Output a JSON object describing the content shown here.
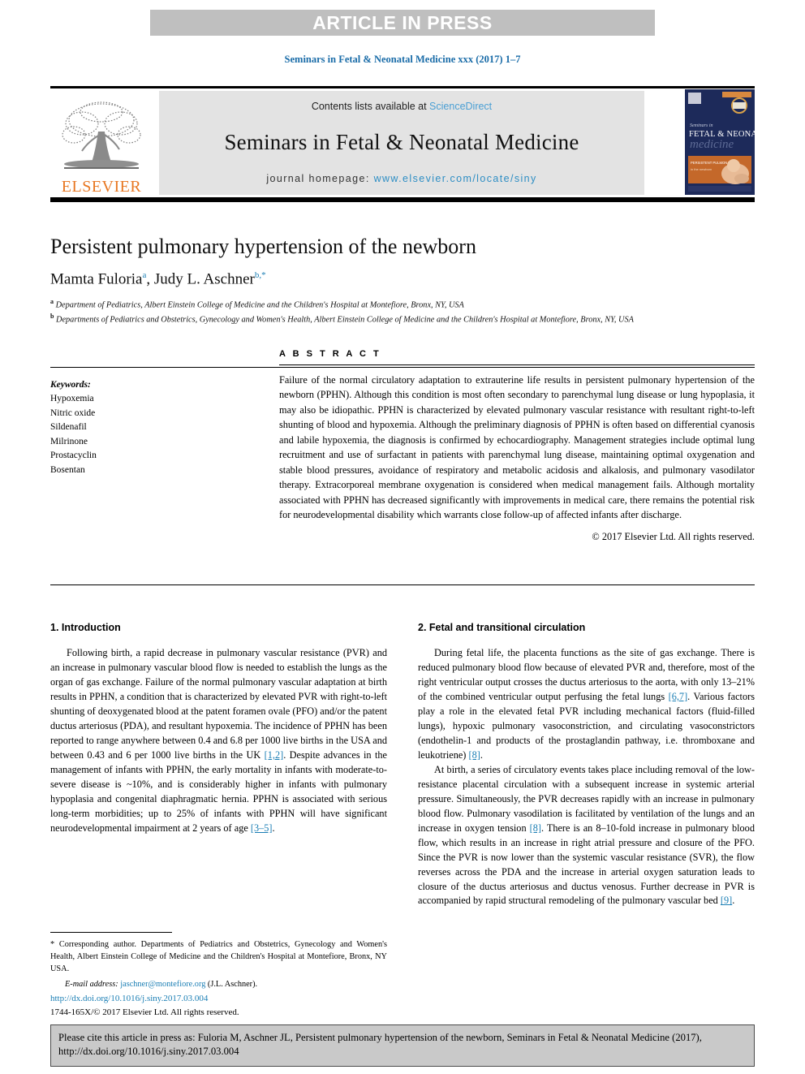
{
  "banner": {
    "text": "ARTICLE IN PRESS"
  },
  "running_citation": "Seminars in Fetal & Neonatal Medicine xxx (2017) 1–7",
  "masthead": {
    "publisher": "ELSEVIER",
    "contents_prefix": "Contents lists available at ",
    "contents_link": "ScienceDirect",
    "journal_name": "Seminars in Fetal & Neonatal Medicine",
    "homepage_prefix": "journal homepage: ",
    "homepage_link": "www.elsevier.com/locate/siny",
    "cover": {
      "line1": "Seminars in",
      "line2": "FETAL & NEONATAL",
      "line3": "medicine",
      "band_text": "PERSISTENT PULMONARY",
      "band_sub": "in the newborn"
    }
  },
  "article": {
    "title": "Persistent pulmonary hypertension of the newborn",
    "authors": "Mamta Fuloria, Judy L. Aschner",
    "author1": "Mamta Fuloria",
    "author1_sup": "a",
    "author2": "Judy L. Aschner",
    "author2_sup": "b,",
    "author2_star": "*",
    "affiliation_a_sup": "a",
    "affiliation_a": "Department of Pediatrics, Albert Einstein College of Medicine and the Children's Hospital at Montefiore, Bronx, NY, USA",
    "affiliation_b_sup": "b",
    "affiliation_b": "Departments of Pediatrics and Obstetrics, Gynecology and Women's Health, Albert Einstein College of Medicine and the Children's Hospital at Montefiore, Bronx, NY, USA"
  },
  "keywords": {
    "heading": "Keywords:",
    "items": [
      "Hypoxemia",
      "Nitric oxide",
      "Sildenafil",
      "Milrinone",
      "Prostacyclin",
      "Bosentan"
    ]
  },
  "abstract": {
    "label": "A B S T R A C T",
    "text": "Failure of the normal circulatory adaptation to extrauterine life results in persistent pulmonary hypertension of the newborn (PPHN). Although this condition is most often secondary to parenchymal lung disease or lung hypoplasia, it may also be idiopathic. PPHN is characterized by elevated pulmonary vascular resistance with resultant right-to-left shunting of blood and hypoxemia. Although the preliminary diagnosis of PPHN is often based on differential cyanosis and labile hypoxemia, the diagnosis is confirmed by echocardiography. Management strategies include optimal lung recruitment and use of surfactant in patients with parenchymal lung disease, maintaining optimal oxygenation and stable blood pressures, avoidance of respiratory and metabolic acidosis and alkalosis, and pulmonary vasodilator therapy. Extracorporeal membrane oxygenation is considered when medical management fails. Although mortality associated with PPHN has decreased significantly with improvements in medical care, there remains the potential risk for neurodevelopmental disability which warrants close follow-up of affected infants after discharge.",
    "copyright": "© 2017 Elsevier Ltd. All rights reserved."
  },
  "sections": {
    "intro": {
      "heading": "1. Introduction",
      "para1_part1": "Following birth, a rapid decrease in pulmonary vascular resistance (PVR) and an increase in pulmonary vascular blood flow is needed to establish the lungs as the organ of gas exchange. Failure of the normal pulmonary vascular adaptation at birth results in PPHN, a condition that is characterized by elevated PVR with right-to-left shunting of deoxygenated blood at the patent foramen ovale (PFO) and/or the patent ductus arteriosus (PDA), and resultant hypoxemia. The incidence of PPHN has been reported to range anywhere between 0.4 and 6.8 per 1000 live births in the USA and between 0.43 and 6 per 1000 live births in the UK ",
      "cite1": "[1,2]",
      "para1_part2": ". Despite advances in the management of infants with PPHN, the early mortality in infants with moderate-to-severe disease is ~10%, and is considerably higher in infants with pulmonary hypoplasia and congenital diaphragmatic hernia. PPHN is associated with serious long-term morbidities; up to 25% of infants with PPHN will have significant neurodevelopmental impairment at 2 years of age ",
      "cite2": "[3–5]",
      "para1_part3": "."
    },
    "fetal": {
      "heading": "2. Fetal and transitional circulation",
      "para1_part1": "During fetal life, the placenta functions as the site of gas exchange. There is reduced pulmonary blood flow because of elevated PVR and, therefore, most of the right ventricular output crosses the ductus arteriosus to the aorta, with only 13–21% of the combined ventricular output perfusing the fetal lungs ",
      "cite1": "[6,7]",
      "para1_part2": ". Various factors play a role in the elevated fetal PVR including mechanical factors (fluid-filled lungs), hypoxic pulmonary vasoconstriction, and circulating vasoconstrictors (endothelin-1 and products of the prostaglandin pathway, i.e. thromboxane and leukotriene) ",
      "cite2": "[8]",
      "para1_part3": ".",
      "para2_part1": "At birth, a series of circulatory events takes place including removal of the low-resistance placental circulation with a subsequent increase in systemic arterial pressure. Simultaneously, the PVR decreases rapidly with an increase in pulmonary blood flow. Pulmonary vasodilation is facilitated by ventilation of the lungs and an increase in oxygen tension ",
      "cite3": "[8]",
      "para2_part2": ". There is an 8–10-fold increase in pulmonary blood flow, which results in an increase in right atrial pressure and closure of the PFO. Since the PVR is now lower than the systemic vascular resistance (SVR), the flow reverses across the PDA and the increase in arterial oxygen saturation leads to closure of the ductus arteriosus and ductus venosus. Further decrease in PVR is accompanied by rapid structural remodeling of the pulmonary vascular bed ",
      "cite4": "[9]",
      "para2_part3": "."
    }
  },
  "footnotes": {
    "star": "*",
    "corresponding": " Corresponding author. Departments of Pediatrics and Obstetrics, Gynecology and Women's Health, Albert Einstein College of Medicine and the Children's Hospital at Montefiore, Bronx, NY USA.",
    "email_label": "E-mail address:",
    "email": "jaschner@montefiore.org",
    "email_owner": "(J.L. Aschner).",
    "doi": "http://dx.doi.org/10.1016/j.siny.2017.03.004",
    "issn_line": "1744-165X/© 2017 Elsevier Ltd. All rights reserved."
  },
  "cite_box": {
    "text": "Please cite this article in press as: Fuloria M, Aschner JL, Persistent pulmonary hypertension of the newborn, Seminars in Fetal & Neonatal Medicine (2017), http://dx.doi.org/10.1016/j.siny.2017.03.004"
  },
  "colors": {
    "link_blue": "#1a7eb4",
    "sciencedirect_blue": "#4a9fd4",
    "elsevier_orange": "#e87722",
    "banner_gray": "#bfbfbf",
    "mast_gray": "#e3e3e3",
    "cite_box_gray": "#c9c9c9"
  }
}
